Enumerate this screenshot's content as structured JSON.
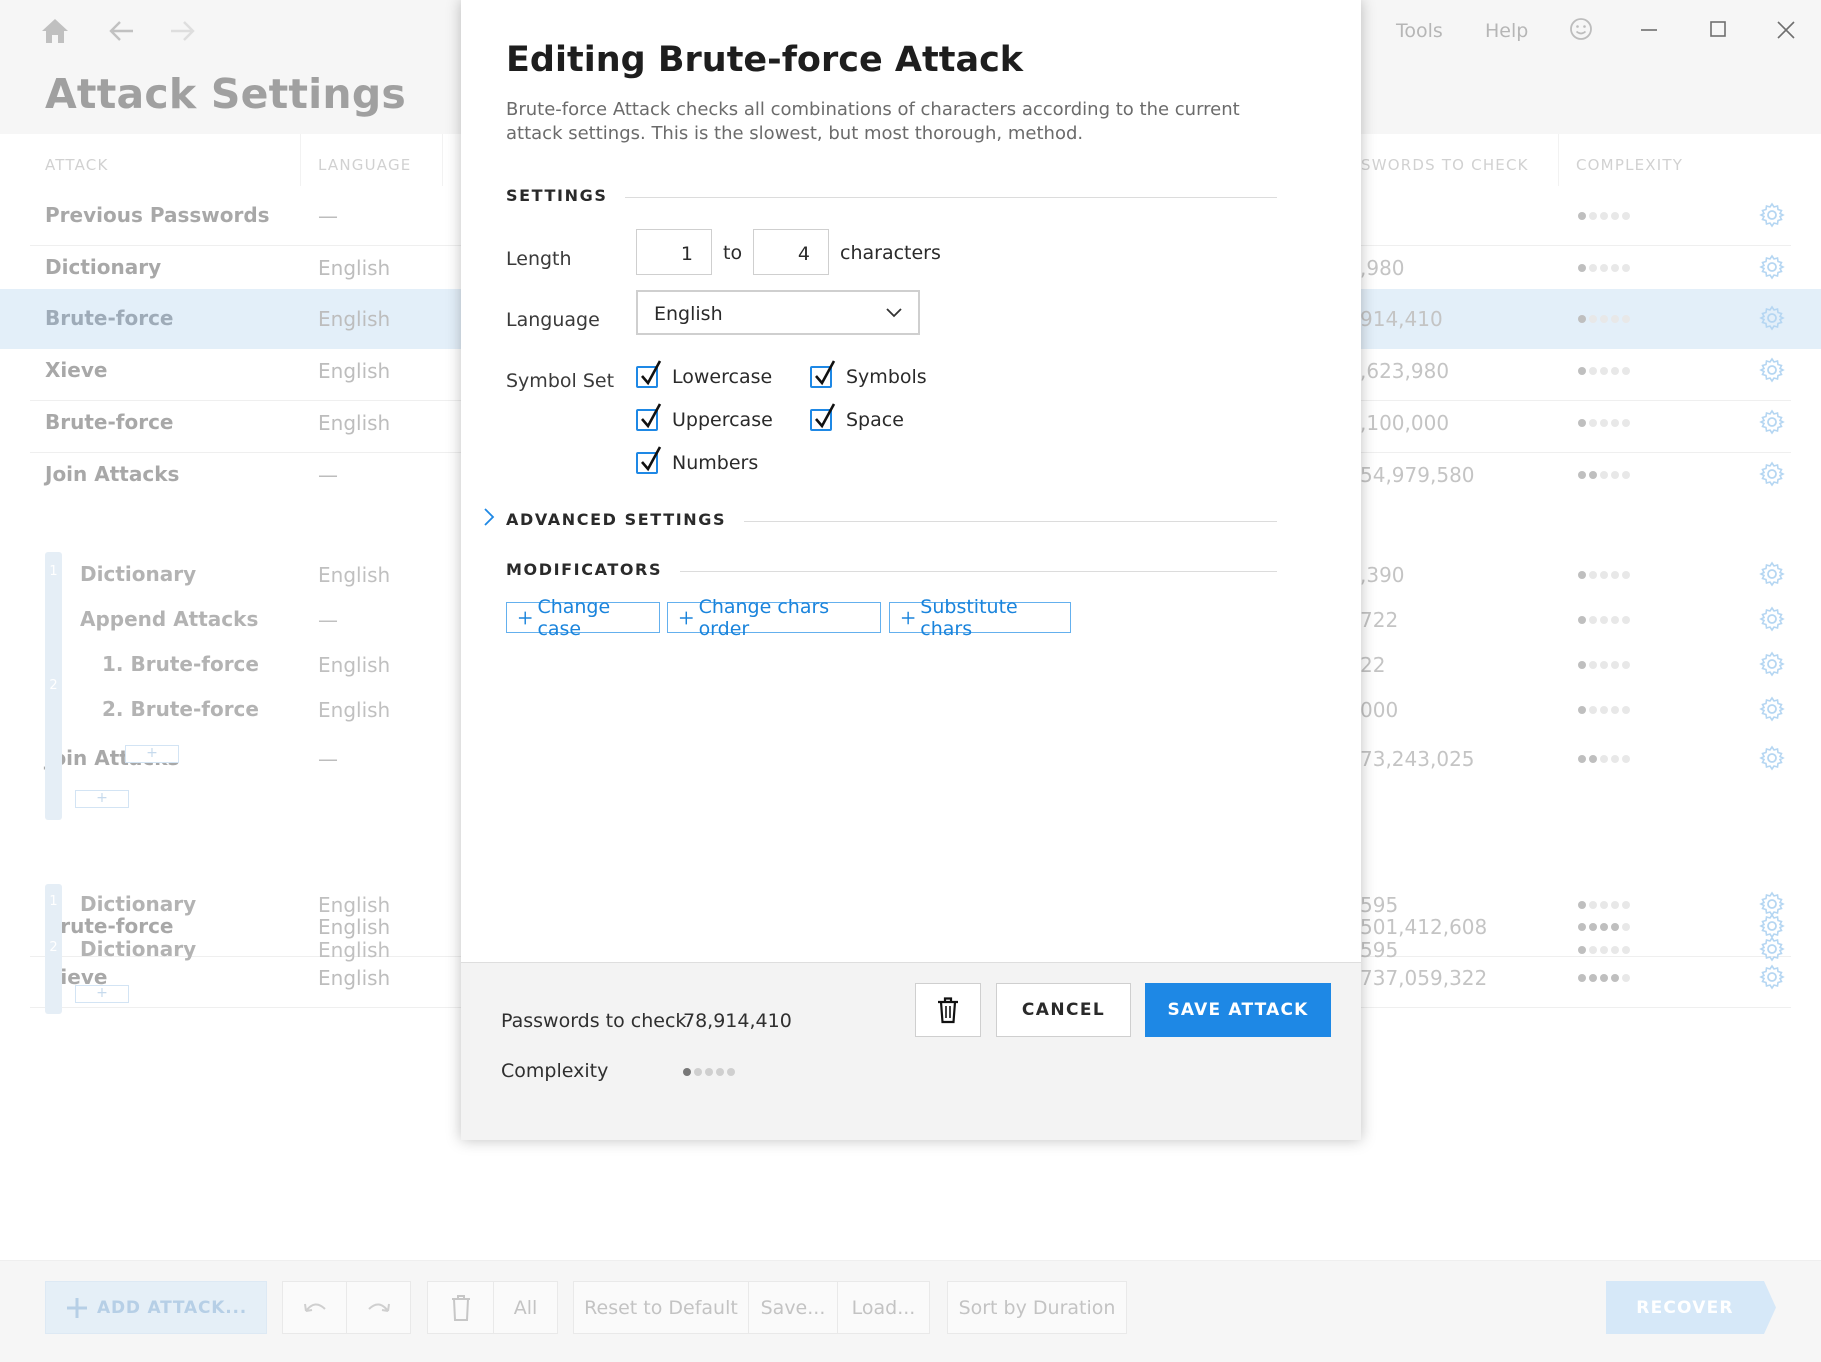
{
  "window": {
    "page_title": "Attack Settings",
    "menu": [
      "Tools",
      "Help"
    ],
    "icons": [
      "home-icon",
      "back-icon",
      "forward-icon",
      "feedback-smiley-icon",
      "minimize-icon",
      "maximize-icon",
      "close-icon"
    ]
  },
  "table": {
    "columns": [
      "ATTACK",
      "LANGUAGE",
      "SWORDS TO CHECK",
      "COMPLEXITY"
    ],
    "rows": [
      {
        "name": "Previous Passwords",
        "language": "—",
        "passwords": "",
        "complexity": 1
      },
      {
        "name": "Dictionary",
        "language": "English",
        "passwords": ",980",
        "complexity": 1
      },
      {
        "name": "Brute-force",
        "language": "English",
        "passwords": "914,410",
        "complexity": 1,
        "selected": true
      },
      {
        "name": "Xieve",
        "language": "English",
        "passwords": ",623,980",
        "complexity": 1
      },
      {
        "name": "Brute-force",
        "language": "English",
        "passwords": ",100,000",
        "complexity": 1
      },
      {
        "name": "Join Attacks",
        "language": "—",
        "passwords": "54,979,580",
        "complexity": 2
      },
      {
        "name": "Join Attacks",
        "language": "—",
        "passwords": "73,243,025",
        "complexity": 2
      },
      {
        "name": "Brute-force",
        "language": "English",
        "passwords": "501,412,608",
        "complexity": 4
      },
      {
        "name": "Xieve",
        "language": "English",
        "passwords": "737,059,322",
        "complexity": 4
      }
    ],
    "join1_children": [
      {
        "num": "1",
        "name": "Dictionary",
        "language": "English",
        "passwords": ",390",
        "complexity": 1
      },
      {
        "num": "2",
        "name": "Append Attacks",
        "language": "—",
        "passwords": "722",
        "complexity": 1
      },
      {
        "num": "",
        "name": "1. Brute-force",
        "language": "English",
        "passwords": "22",
        "complexity": 1
      },
      {
        "num": "",
        "name": "2. Brute-force",
        "language": "English",
        "passwords": "000",
        "complexity": 1
      }
    ],
    "join2_children": [
      {
        "num": "1",
        "name": "Dictionary",
        "language": "English",
        "passwords": "595",
        "complexity": 1
      },
      {
        "num": "2",
        "name": "Dictionary",
        "language": "English",
        "passwords": "595",
        "complexity": 1
      }
    ],
    "add_mini_label": "+"
  },
  "footer": {
    "add_attack": "ADD ATTACK...",
    "all": "All",
    "reset": "Reset to Default",
    "save": "Save...",
    "load": "Load...",
    "sort": "Sort by Duration",
    "recover": "RECOVER"
  },
  "dialog": {
    "title": "Editing Brute-force Attack",
    "description": "Brute-force Attack checks all combinations of characters according to the current attack settings. This is the slowest, but most thorough, method.",
    "settings_header": "SETTINGS",
    "length_label": "Length",
    "length_from": "1",
    "length_to_word": "to",
    "length_to": "4",
    "length_unit": "characters",
    "language_label": "Language",
    "language_value": "English",
    "symbol_set_label": "Symbol Set",
    "symbols": [
      {
        "label": "Lowercase",
        "checked": true
      },
      {
        "label": "Uppercase",
        "checked": true
      },
      {
        "label": "Numbers",
        "checked": true
      },
      {
        "label": "Symbols",
        "checked": true
      },
      {
        "label": "Space",
        "checked": true
      }
    ],
    "advanced_header": "ADVANCED SETTINGS",
    "modificators_header": "MODIFICATORS",
    "modificators": [
      "Change case",
      "Change chars order",
      "Substitute chars"
    ],
    "passwords_label": "Passwords to check",
    "passwords_value": "78,914,410",
    "complexity_label": "Complexity",
    "complexity_level": 1,
    "cancel": "CANCEL",
    "save": "SAVE ATTACK"
  },
  "colors": {
    "accent": "#1e88e5",
    "selected_row": "#d4e6f6"
  }
}
